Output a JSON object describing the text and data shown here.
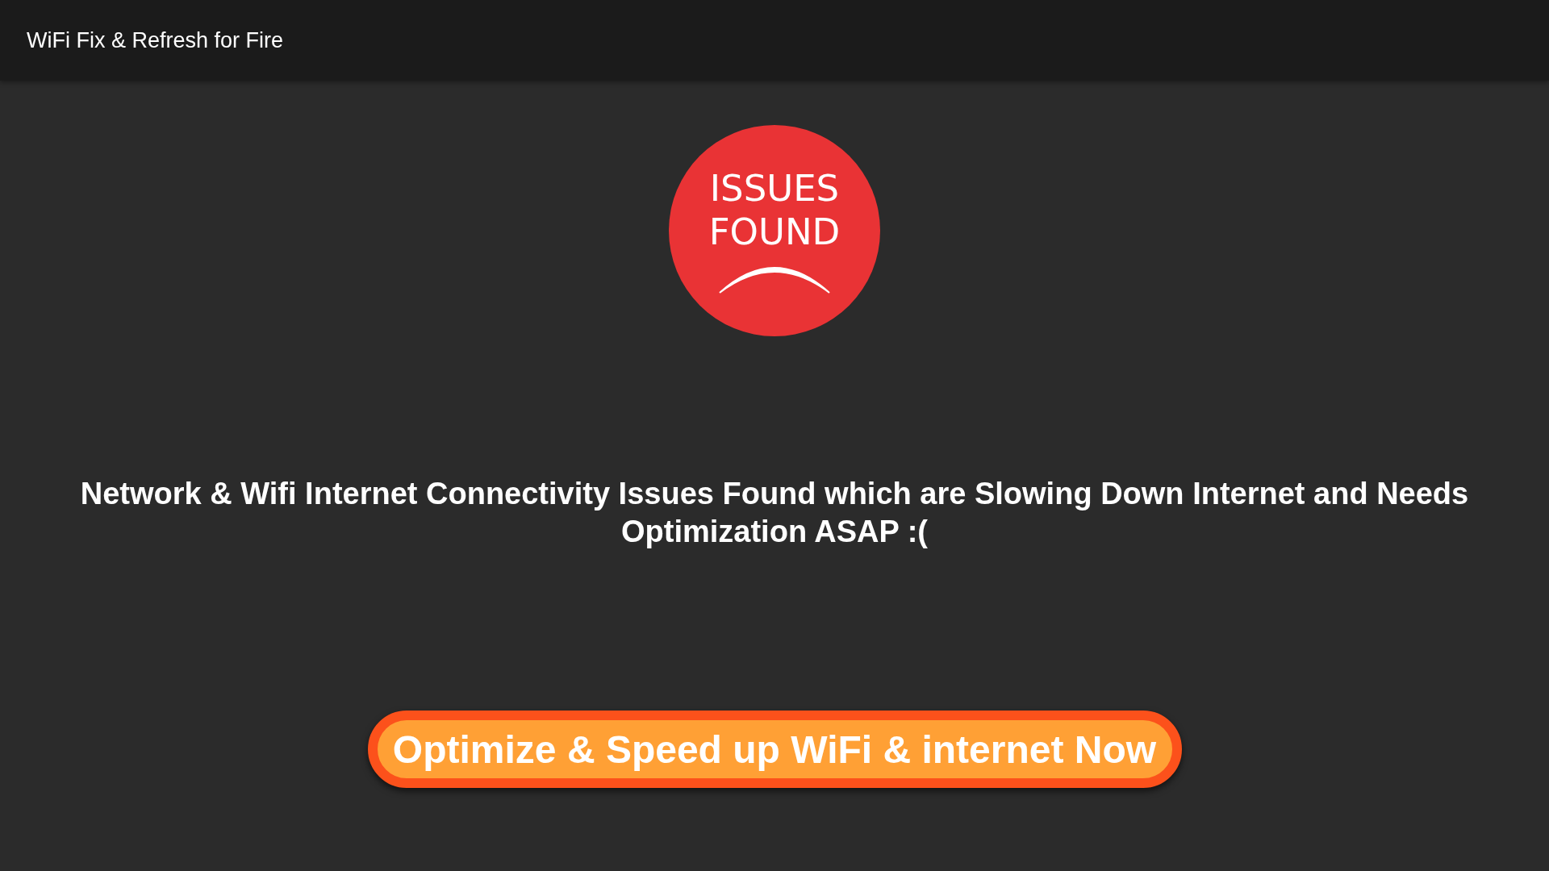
{
  "app_bar": {
    "title": "WiFi Fix & Refresh for Fire"
  },
  "status_badge": {
    "lines": [
      "ISSUES",
      "FOUND"
    ]
  },
  "message": "Network & Wifi Internet Connectivity Issues Found which are Slowing Down Internet and Needs Optimization ASAP :(",
  "action_button": {
    "label": "Optimize & Speed up WiFi & internet Now"
  }
}
